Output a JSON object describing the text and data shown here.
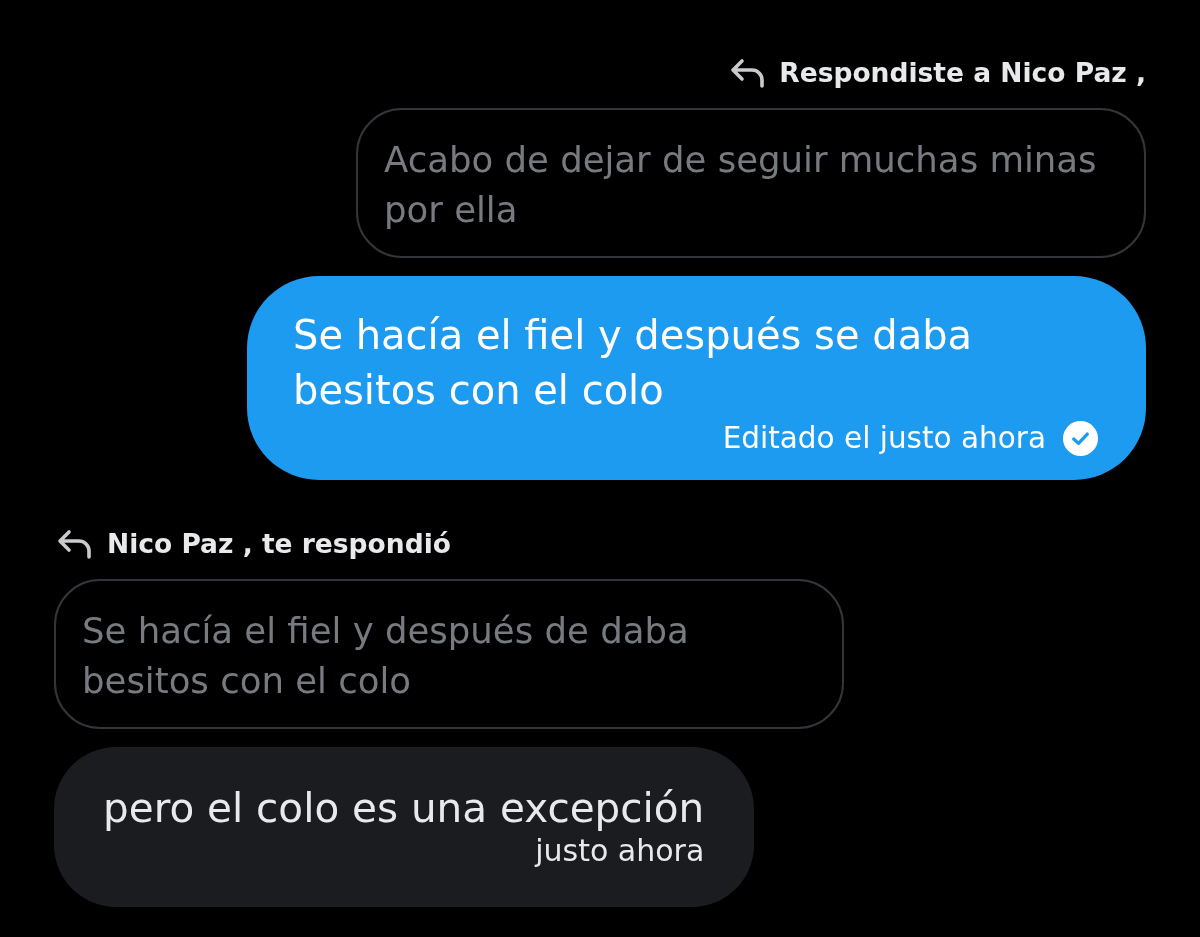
{
  "messages": [
    {
      "kind": "sent",
      "reply_label": "Respondiste a Nico Paz ,",
      "quoted": "Acabo de dejar de seguir muchas minas por ella",
      "text": "Se hacía el fiel y después se daba besitos con el colo",
      "edited_label": "Editado el justo ahora",
      "seen": true
    },
    {
      "kind": "received",
      "reply_label": "Nico Paz , te respondió",
      "quoted": "Se hacía el fiel y después de daba besitos con el colo",
      "text": "pero el colo es una excepción",
      "time": "justo ahora"
    }
  ]
}
